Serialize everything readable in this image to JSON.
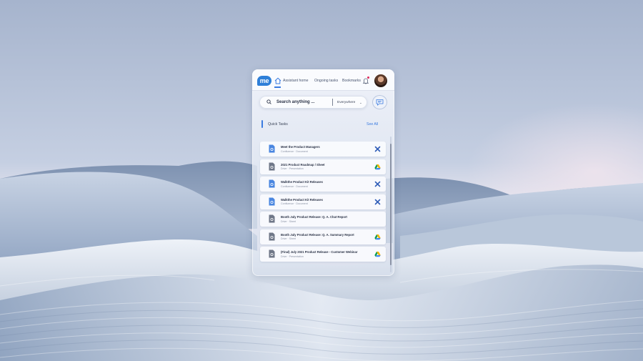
{
  "app": {
    "logo_text": "me",
    "nav": [
      "Assistant home",
      "Ongoing tasks",
      "Bookmarks"
    ],
    "accent": "#3a7be0"
  },
  "search": {
    "placeholder": "Search anything ...",
    "scope": "Everywhere",
    "scope_chevron": "⌄"
  },
  "quick_tasks": {
    "title": "Quick Tasks",
    "see_all": "See All",
    "items": [
      {
        "title": "Meet the Product Managers",
        "sub": "Confluence · Document",
        "icon": "doc-blue-icon",
        "action": "confluence-icon"
      },
      {
        "title": "2021 Product Roadmap / Sheet",
        "sub": "Drive · Presentation",
        "icon": "doc-grey-icon",
        "action": "google-drive-icon"
      },
      {
        "title": "Walkthe Product Kit Releases",
        "sub": "Confluence · Document",
        "icon": "doc-blue-icon",
        "action": "confluence-icon"
      },
      {
        "title": "Walkthe Product Kit Releases",
        "sub": "Confluence · Document",
        "icon": "doc-blue-icon",
        "action": "confluence-icon"
      },
      {
        "title": "Booth July Product Release: Q. A. Chat Report",
        "sub": "Drive · Sheet",
        "icon": "doc-grey-icon",
        "action": "none"
      },
      {
        "title": "Booth July Product Release: Q. A. Summary Report",
        "sub": "Drive · Sheet",
        "icon": "doc-grey-icon",
        "action": "google-drive-icon"
      },
      {
        "title": "(Final) July 2021 Product Release - Customer Webinar",
        "sub": "Drive · Presentation",
        "icon": "doc-grey-icon",
        "action": "google-drive-icon"
      }
    ]
  }
}
